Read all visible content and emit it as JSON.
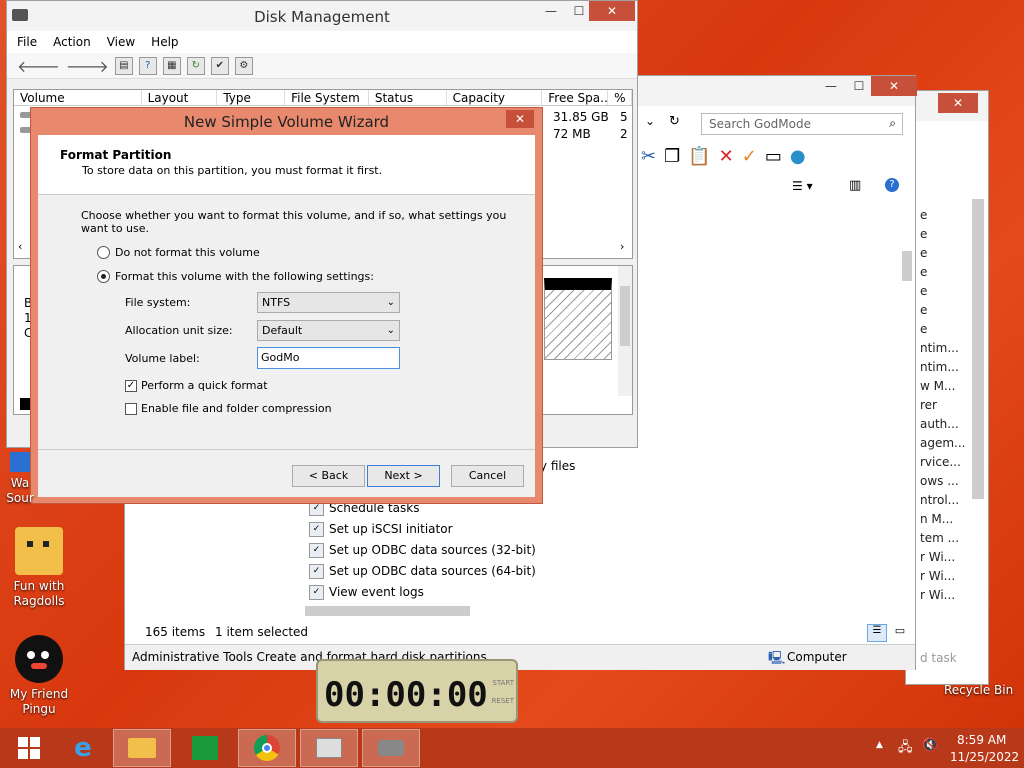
{
  "desktop": {
    "icons": [
      {
        "label": "Wa Sour"
      },
      {
        "label": "Fun with Ragdolls"
      },
      {
        "label": "My Friend Pingu"
      }
    ],
    "recycle_bin_label": "Recycle Bin"
  },
  "disk_management": {
    "title": "Disk Management",
    "menu": [
      "File",
      "Action",
      "View",
      "Help"
    ],
    "columns": [
      "Volume",
      "Layout",
      "Type",
      "File System",
      "Status",
      "Capacity",
      "Free Spa...",
      "%"
    ],
    "rows": [
      {
        "free": "31.85 GB",
        "pct": "5"
      },
      {
        "free": "72 MB",
        "pct": "2"
      }
    ],
    "disk_labels": [
      "B",
      "1",
      "C"
    ]
  },
  "wizard": {
    "title": "New Simple Volume Wizard",
    "header_title": "Format Partition",
    "header_subtitle": "To store data on this partition, you must format it first.",
    "instruction": "Choose whether you want to format this volume, and if so, what settings you want to use.",
    "option_no_format": "Do not format this volume",
    "option_format": "Format this volume with the following settings:",
    "file_system_label": "File system:",
    "file_system_value": "NTFS",
    "allocation_label": "Allocation unit size:",
    "allocation_value": "Default",
    "volume_label_label": "Volume label:",
    "volume_label_value": "GodMo",
    "quick_format_label": "Perform a quick format",
    "quick_format_checked": true,
    "compression_label": "Enable file and folder compression",
    "compression_checked": false,
    "back_button": "< Back",
    "next_button": "Next >",
    "cancel_button": "Cancel",
    "close_glyph": "✕"
  },
  "explorer": {
    "search_placeholder": "Search GodMode",
    "partial_text": "ry files",
    "tasks": [
      "Schedule tasks",
      "Set up iSCSI initiator",
      "Set up ODBC data sources (32-bit)",
      "Set up ODBC data sources (64-bit)",
      "View event logs"
    ],
    "status_items": "165 items",
    "status_selected": "1 item selected",
    "description": "Administrative Tools Create and format hard disk partitions",
    "location": "Computer"
  },
  "back_window": {
    "partial_items": [
      "e",
      "e",
      "e",
      "e",
      "e",
      "e",
      "e",
      "ntim...",
      "ntim...",
      "w M...",
      "rer",
      "auth...",
      "agem...",
      "rvice...",
      "ows ...",
      "ntrol...",
      "n M...",
      "tem ...",
      "r Wi...",
      "r Wi...",
      "r Wi..."
    ],
    "task_label": "d task"
  },
  "timer": {
    "digits": "00:00:00",
    "start_label": "START",
    "reset_label": "RESET"
  },
  "taskbar": {
    "time": "8:59 AM",
    "date": "11/25/2022"
  }
}
